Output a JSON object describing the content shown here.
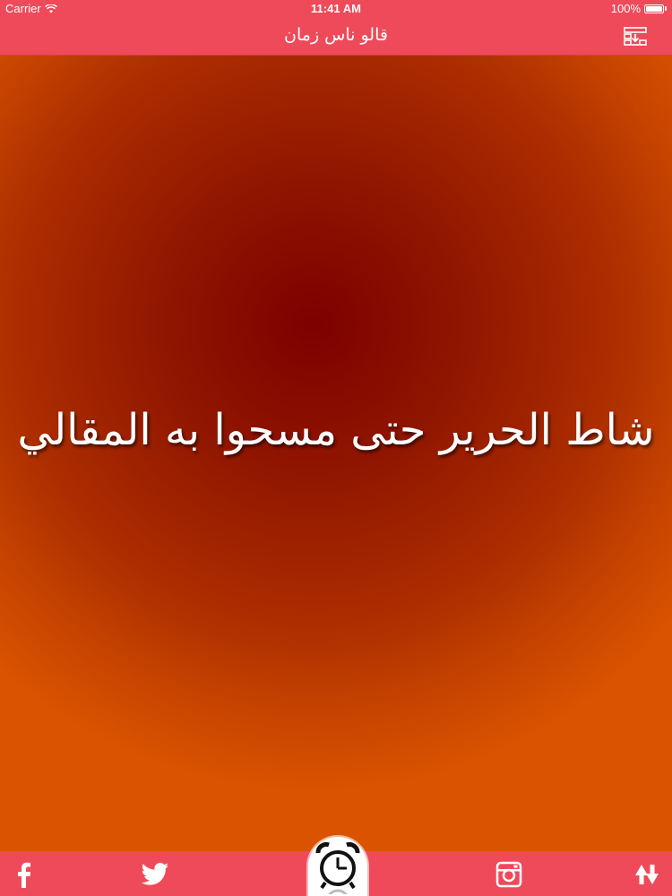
{
  "status_bar": {
    "carrier": "Carrier",
    "time": "11:41 AM",
    "battery": "100%"
  },
  "nav": {
    "title": "قالو ناس زمان",
    "right_icon": "download-list-icon"
  },
  "content": {
    "quote": "شاط الحرير حتى مسحوا به المقالي"
  },
  "tab_bar": {
    "items": [
      {
        "icon": "facebook-icon"
      },
      {
        "icon": "twitter-icon"
      },
      {
        "icon": "alarm-clock-icon"
      },
      {
        "icon": "instagram-icon"
      },
      {
        "icon": "share-arrows-icon"
      }
    ]
  },
  "colors": {
    "bar": "#ef4a5a",
    "bg_dark": "#7d0000",
    "bg_light": "#d95300"
  }
}
